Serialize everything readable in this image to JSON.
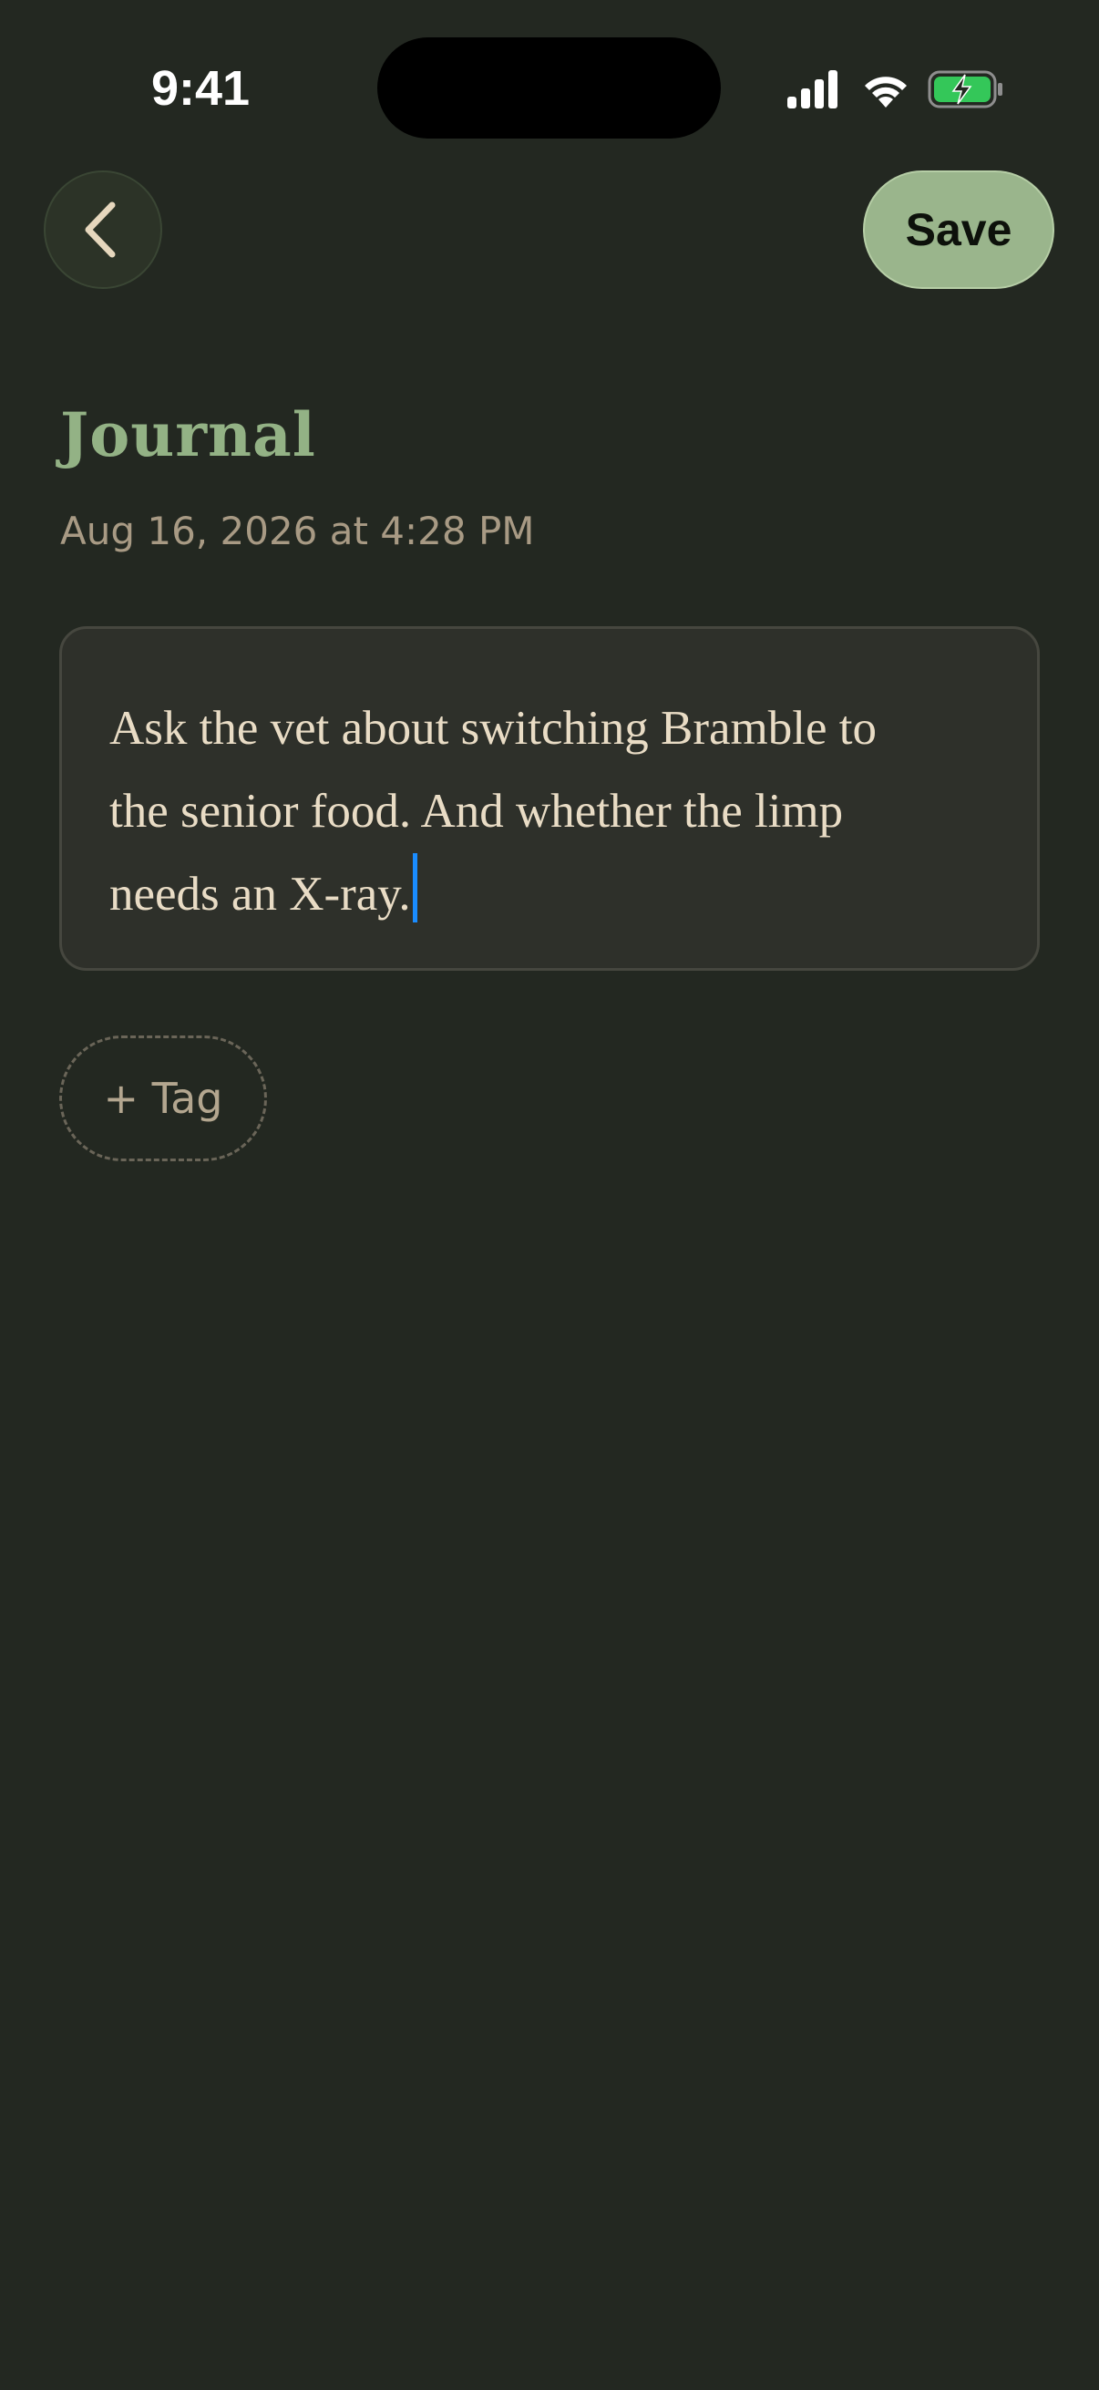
{
  "status_bar": {
    "time": "9:41"
  },
  "header": {
    "save_label": "Save"
  },
  "page": {
    "title": "Journal",
    "date": "Aug 16, 2026 at 4:28 PM"
  },
  "note": {
    "text": "Ask the vet about switching Bramble to\nthe senior food. And whether the limp\nneeds an X-ray."
  },
  "tag_button": {
    "label": "+ Tag"
  },
  "colors": {
    "background": "#232821",
    "accent": "#93b285",
    "save_button": "#9ab58c",
    "caret": "#1a8cff",
    "battery": "#34c759"
  }
}
